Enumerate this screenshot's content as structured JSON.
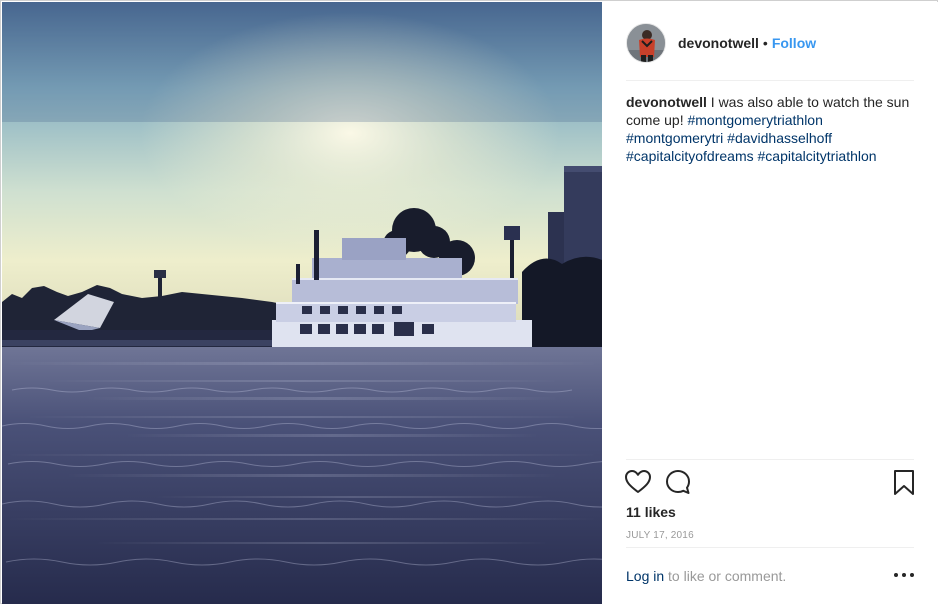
{
  "post": {
    "username": "devonotwell",
    "separator": "•",
    "follow_label": "Follow",
    "caption": {
      "username": "devonotwell",
      "text": " I was also able to watch the sun come up! ",
      "hashtags": [
        "#montgomerytriathlon",
        "#montgomerytri",
        "#davidhasselhoff",
        "#capitalcityofdreams",
        "#capitalcitytriathlon"
      ]
    },
    "likes": "11 likes",
    "date": "JULY 17, 2016",
    "login_link": "Log in",
    "login_rest": " to like or comment."
  },
  "icons": {
    "like": "heart-icon",
    "comment": "comment-icon",
    "save": "bookmark-icon",
    "more": "more-options-icon"
  },
  "colors": {
    "link": "#3897f0",
    "hashtag": "#003569",
    "muted": "#999999",
    "text": "#262626"
  }
}
